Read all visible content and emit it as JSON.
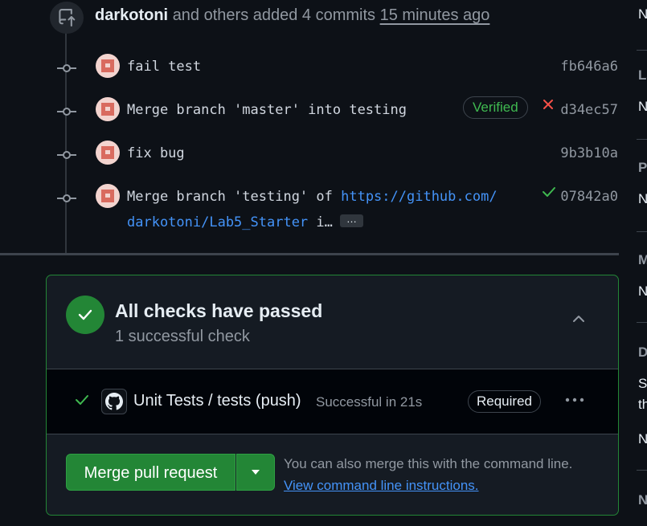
{
  "event": {
    "user": "darkotoni",
    "action_text": "and others added 4 commits",
    "time": "15 minutes ago"
  },
  "commits": [
    {
      "message": "fail test",
      "sha": "fb646a6"
    },
    {
      "message": "Merge branch 'master' into testing",
      "sha": "d34ec57",
      "badge": "Verified",
      "status": "failure"
    },
    {
      "message": "fix bug",
      "sha": "9b3b10a"
    },
    {
      "message_prefix": "Merge branch 'testing' of ",
      "message_link": "https://github.com/",
      "message_link2": "darkotoni/Lab5_Starter",
      "message_suffix": " i…",
      "sha": "07842a0",
      "status": "success",
      "more": "…"
    }
  ],
  "checks": {
    "title": "All checks have passed",
    "subtitle": "1 successful check",
    "items": [
      {
        "name": "Unit Tests / tests (push)",
        "status": "Successful in 21s",
        "badge": "Required"
      }
    ]
  },
  "merge": {
    "button_label": "Merge pull request",
    "note": "You can also merge this with the command line.",
    "link": "View command line instructions."
  },
  "sidebar_letters": [
    "N",
    "La",
    "N",
    "P",
    "N",
    "M",
    "N",
    "D",
    "Si",
    "th",
    "N",
    "N"
  ],
  "colors": {
    "background": "#0d1117",
    "success": "#3fb950",
    "failure": "#f85149",
    "link": "#4493f8",
    "merge_green": "#238636"
  }
}
